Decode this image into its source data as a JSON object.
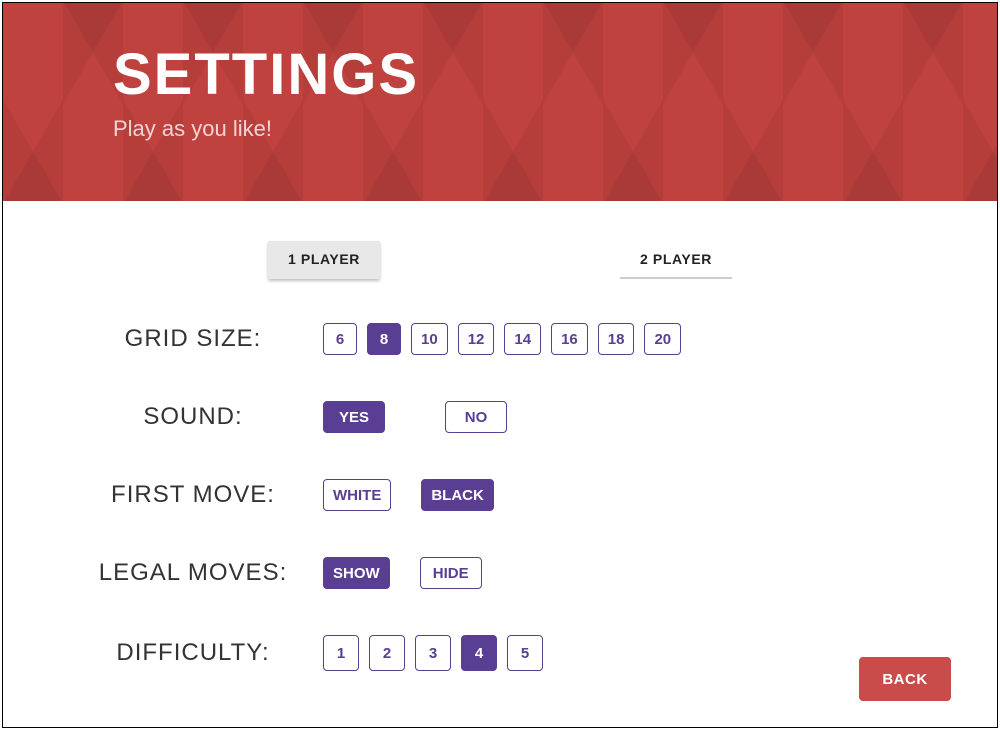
{
  "header": {
    "title": "SETTINGS",
    "subtitle": "Play as you like!"
  },
  "tabs": {
    "one_player": "1 PLAYER",
    "two_player": "2 PLAYER",
    "active": "one_player"
  },
  "settings": {
    "grid_size": {
      "label": "GRID SIZE:",
      "options": [
        "6",
        "8",
        "10",
        "12",
        "14",
        "16",
        "18",
        "20"
      ],
      "selected": "8"
    },
    "sound": {
      "label": "SOUND:",
      "options": [
        "YES",
        "NO"
      ],
      "selected": "YES"
    },
    "first_move": {
      "label": "FIRST MOVE:",
      "options": [
        "WHITE",
        "BLACK"
      ],
      "selected": "BLACK"
    },
    "legal_moves": {
      "label": "LEGAL MOVES:",
      "options": [
        "SHOW",
        "HIDE"
      ],
      "selected": "SHOW"
    },
    "difficulty": {
      "label": "DIFFICULTY:",
      "options": [
        "1",
        "2",
        "3",
        "4",
        "5"
      ],
      "selected": "4"
    }
  },
  "back_button": "BACK",
  "colors": {
    "accent_purple": "#5a3e93",
    "header_red": "#c0423e",
    "button_red": "#c94c4a"
  }
}
